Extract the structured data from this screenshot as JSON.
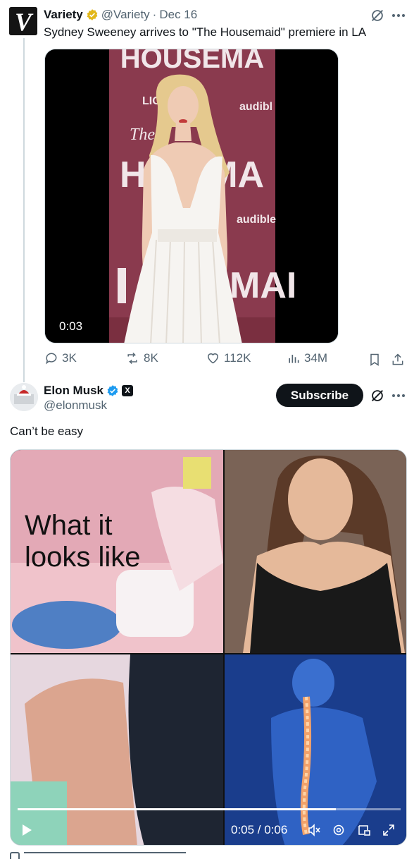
{
  "quoted_tweet": {
    "display_name": "Variety",
    "handle": "@Variety",
    "separator": "·",
    "date": "Dec 16",
    "text": "Sydney Sweeney arrives to \"The Housemaid\" premiere in LA",
    "avatar_letter": "V",
    "video": {
      "timestamp": "0:03",
      "backdrop_text_top": "HOUSEMA",
      "backdrop_text_lion": "LIO",
      "backdrop_text_audible": "audibl",
      "backdrop_text_the": "The",
      "backdrop_text_hmid": "H      MA",
      "backdrop_text_audible2": "audible",
      "backdrop_text_bottom": "MAI"
    },
    "actions": {
      "replies": "3K",
      "reposts": "8K",
      "likes": "112K",
      "views": "34M"
    }
  },
  "main_tweet": {
    "display_name": "Elon Musk",
    "handle": "@elonmusk",
    "affiliate_badge": "X",
    "subscribe_label": "Subscribe",
    "text": "Can’t be easy",
    "video": {
      "panel_caption": "What it\nlooks like",
      "time": "0:05 / 0:06",
      "progress": 0.83
    }
  },
  "colors": {
    "verified_gold": "#E2B719",
    "verified_blue": "#1D9BF0",
    "text_primary": "#0F1419",
    "text_secondary": "#536471",
    "backdrop_maroon": "#8A3A4E"
  },
  "icons": [
    "grok-icon",
    "more-icon",
    "reply-icon",
    "repost-icon",
    "like-icon",
    "views-icon",
    "bookmark-icon",
    "share-icon",
    "play-icon",
    "mute-icon",
    "settings-icon",
    "pip-icon",
    "fullscreen-icon"
  ]
}
